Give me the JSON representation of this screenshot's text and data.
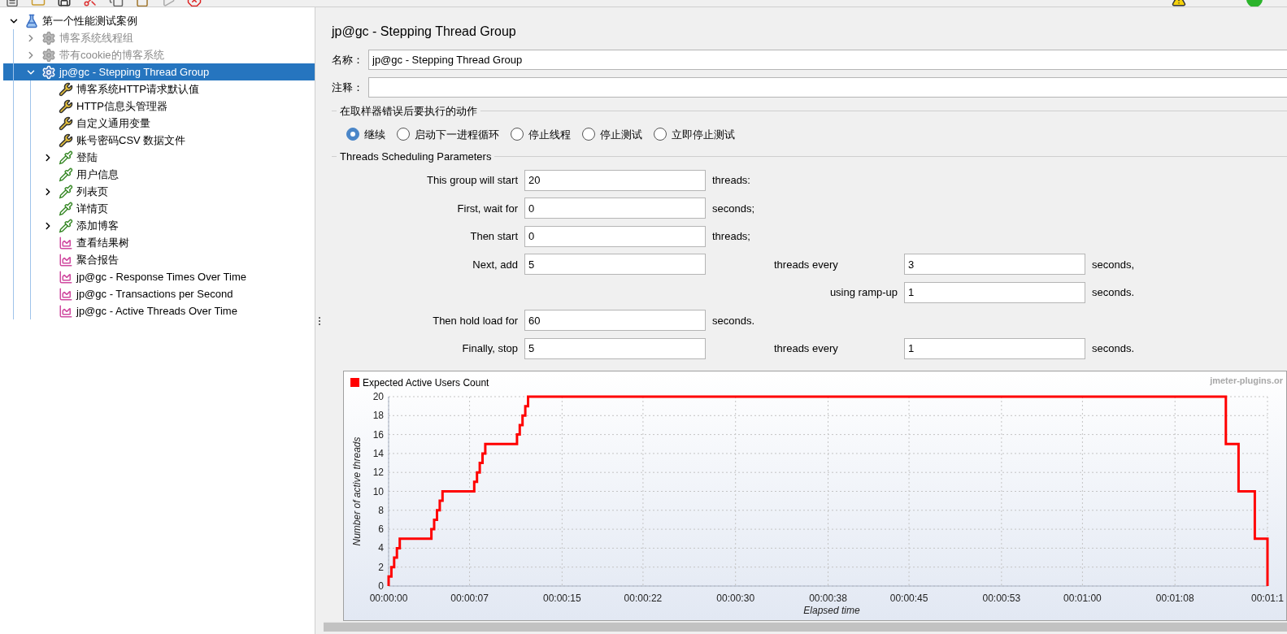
{
  "tree": [
    {
      "label": "第一个性能测试案例",
      "kind": "test-plan",
      "expanded": true,
      "selected": false,
      "disabled": false,
      "children": [
        {
          "label": "博客系统线程组",
          "kind": "thread-group",
          "expanded": false,
          "selected": false,
          "disabled": true
        },
        {
          "label": "带有cookie的博客系统",
          "kind": "thread-group",
          "expanded": false,
          "selected": false,
          "disabled": true
        },
        {
          "label": "jp@gc - Stepping Thread Group",
          "kind": "thread-group",
          "expanded": true,
          "selected": true,
          "disabled": false,
          "children": [
            {
              "label": "博客系统HTTP请求默认值",
              "kind": "config",
              "selected": false,
              "disabled": false
            },
            {
              "label": "HTTP信息头管理器",
              "kind": "config",
              "selected": false,
              "disabled": false
            },
            {
              "label": "自定义通用变量",
              "kind": "config",
              "selected": false,
              "disabled": false
            },
            {
              "label": "账号密码CSV 数据文件",
              "kind": "config",
              "selected": false,
              "disabled": false
            },
            {
              "label": "登陆",
              "kind": "sampler",
              "expanded": false,
              "selected": false,
              "disabled": false
            },
            {
              "label": "用户信息",
              "kind": "sampler",
              "selected": false,
              "disabled": false
            },
            {
              "label": "列表页",
              "kind": "sampler",
              "expanded": false,
              "selected": false,
              "disabled": false
            },
            {
              "label": "详情页",
              "kind": "sampler",
              "selected": false,
              "disabled": false
            },
            {
              "label": "添加博客",
              "kind": "sampler",
              "expanded": false,
              "selected": false,
              "disabled": false
            },
            {
              "label": "查看结果树",
              "kind": "listener",
              "selected": false,
              "disabled": false
            },
            {
              "label": "聚合报告",
              "kind": "listener",
              "selected": false,
              "disabled": false
            },
            {
              "label": "jp@gc - Response Times Over Time",
              "kind": "listener",
              "selected": false,
              "disabled": false
            },
            {
              "label": "jp@gc - Transactions per Second",
              "kind": "listener",
              "selected": false,
              "disabled": false
            },
            {
              "label": "jp@gc - Active Threads Over Time",
              "kind": "listener",
              "selected": false,
              "disabled": false
            }
          ]
        }
      ]
    }
  ],
  "panel": {
    "title": "jp@gc - Stepping Thread Group",
    "name": {
      "label": "名称：",
      "value": "jp@gc - Stepping Thread Group"
    },
    "comment": {
      "label": "注释："
    },
    "on_error": {
      "title": "在取样器错误后要执行的动作",
      "options": [
        {
          "label": "继续",
          "selected": true
        },
        {
          "label": "启动下一进程循环",
          "selected": false
        },
        {
          "label": "停止线程",
          "selected": false
        },
        {
          "label": "停止测试",
          "selected": false
        },
        {
          "label": "立即停止测试",
          "selected": false
        }
      ]
    },
    "scheduling": {
      "title": "Threads Scheduling Parameters",
      "rows": [
        {
          "kind": "single",
          "label": "This group will start",
          "value": "20",
          "unit": "threads:"
        },
        {
          "kind": "single",
          "label": "First, wait for",
          "value": "0",
          "unit": "seconds;"
        },
        {
          "kind": "single",
          "label": "Then start",
          "value": "0",
          "unit": "threads;"
        },
        {
          "kind": "double",
          "label": "Next, add",
          "value": "5",
          "mid_label": "threads every",
          "value2": "3",
          "unit2": "seconds,"
        },
        {
          "kind": "ramp",
          "label": "using ramp-up",
          "value": "1",
          "unit": "seconds."
        },
        {
          "kind": "single",
          "label": "Then hold load for",
          "value": "60",
          "unit": "seconds."
        },
        {
          "kind": "double",
          "label": "Finally, stop",
          "value": "5",
          "mid_label": "threads every",
          "value2": "1",
          "unit2": "seconds."
        }
      ]
    },
    "chart": {
      "watermark": "jmeter-plugins.or",
      "chart_data": {
        "type": "line",
        "xlabel": "Elapsed time",
        "ylabel": "Number of active threads",
        "grid": true,
        "xlim": [
          0,
          76
        ],
        "ylim": [
          0,
          20
        ],
        "xticks": [
          {
            "value": 0,
            "label": "00:00:00"
          },
          {
            "value": 7,
            "label": "00:00:07"
          },
          {
            "value": 15,
            "label": "00:00:15"
          },
          {
            "value": 22,
            "label": "00:00:22"
          },
          {
            "value": 30,
            "label": "00:00:30"
          },
          {
            "value": 38,
            "label": "00:00:38"
          },
          {
            "value": 45,
            "label": "00:00:45"
          },
          {
            "value": 53,
            "label": "00:00:53"
          },
          {
            "value": 60,
            "label": "00:01:00"
          },
          {
            "value": 68,
            "label": "00:01:08"
          },
          {
            "value": 76,
            "label": "00:01:1"
          }
        ],
        "yticks": [
          0,
          2,
          4,
          6,
          8,
          10,
          12,
          14,
          16,
          18,
          20
        ],
        "x": [
          0,
          0,
          0.24,
          0.24,
          0.48,
          0.48,
          0.72,
          0.72,
          0.96,
          0.96,
          3.7,
          3.7,
          3.94,
          3.94,
          4.18,
          4.18,
          4.42,
          4.42,
          4.66,
          4.66,
          7.4,
          7.4,
          7.64,
          7.64,
          7.88,
          7.88,
          8.12,
          8.12,
          8.36,
          8.36,
          11.1,
          11.1,
          11.34,
          11.34,
          11.58,
          11.58,
          11.82,
          11.82,
          12.06,
          12.06,
          72.4,
          72.4,
          73.5,
          73.5,
          74.9,
          74.9,
          76,
          76
        ],
        "series": [
          {
            "name": "Expected Active Users Count",
            "color": "#ff0000",
            "values": [
              0,
              1,
              1,
              2,
              2,
              3,
              3,
              4,
              4,
              5,
              5,
              6,
              6,
              7,
              7,
              8,
              8,
              9,
              9,
              10,
              10,
              11,
              11,
              12,
              12,
              13,
              13,
              14,
              14,
              15,
              15,
              16,
              16,
              17,
              17,
              18,
              18,
              19,
              19,
              20,
              20,
              15,
              15,
              10,
              10,
              5,
              5,
              0
            ]
          }
        ]
      }
    }
  }
}
